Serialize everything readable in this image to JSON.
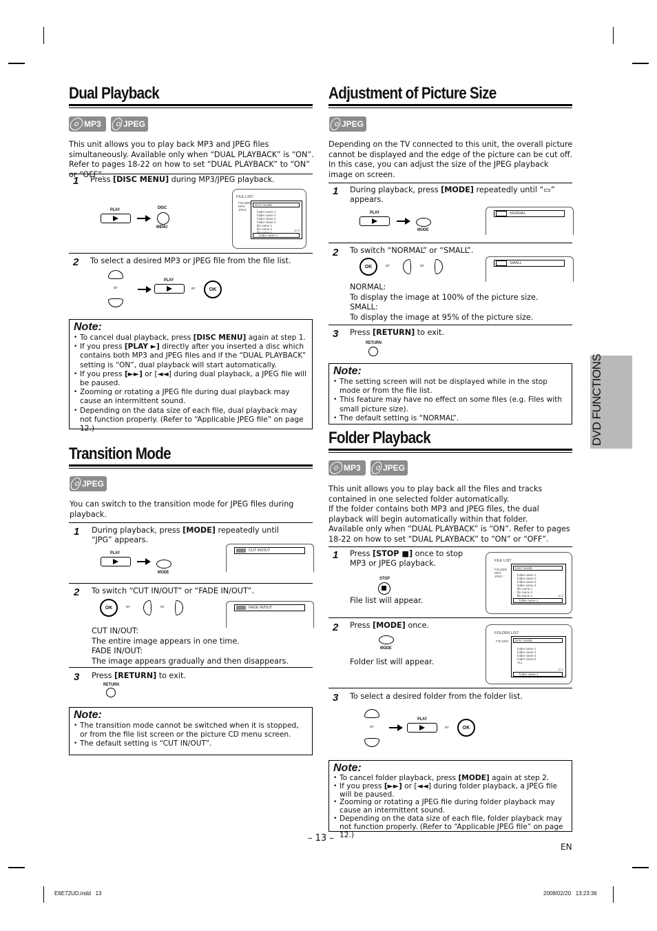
{
  "page": {
    "number_label": "– 13 –",
    "lang": "EN",
    "side_tab": "DVD FUNCTIONS",
    "footer_left": "E6E72UD.indd   13",
    "footer_right": "2008/02/20   13:23:36"
  },
  "badges": {
    "mp3": "MP3",
    "jpeg": "JPEG"
  },
  "buttons": {
    "play": "PLAY",
    "disc_menu_top": "DISC",
    "disc_menu_bottom": "MENU",
    "ok": "OK",
    "mode": "MODE",
    "return": "RETURN",
    "stop": "STOP",
    "or": "or"
  },
  "dual_playback": {
    "title": "Dual Playback",
    "intro": "This unit allows you to play back MP3 and JPEG files simultaneously. Available only when “DUAL PLAYBACK” is “ON”. Refer to pages 18-22 on how to set “DUAL PLAYBACK” to “ON” or “OFF”.",
    "steps": [
      {
        "num": "1",
        "pre": "Press ",
        "bold": "[DISC MENU]",
        "post": " during MP3/JPEG playback."
      },
      {
        "num": "2",
        "text": "To select a desired MP3 or JPEG file from the file list."
      }
    ],
    "file_list": {
      "title": "FILE LIST",
      "disc_name": "DISC NAME",
      "legend": [
        "FOLDER",
        "MP3",
        "JPEG"
      ],
      "rows": [
        "folder name 1",
        "folder name 2",
        "folder name 3",
        "folder name 4",
        "file name 1",
        "file name 2",
        "file name 1"
      ],
      "page": "1/  2",
      "current": "folder name 1"
    },
    "note": {
      "title": "Note:",
      "items": [
        {
          "pre": "To cancel dual playback, press ",
          "bold": "[DISC MENU]",
          "post": " again at step 1."
        },
        {
          "pre": "If you press ",
          "bold": "[PLAY ►]",
          "post": " directly after you inserted a disc which contains both MP3 and JPEG files and if the “DUAL PLAYBACK” setting is “ON”, dual playback will start automatically."
        },
        {
          "pre": "If you press ",
          "bold": "[►►]",
          "post": " or [◄◄] during dual playback, a JPEG file will be paused."
        },
        {
          "pre": "Zooming or rotating a JPEG file during dual playback may cause an intermittent sound.",
          "bold": "",
          "post": ""
        },
        {
          "pre": "Depending on the data size of each file, dual playback may not function properly. (Refer to “Applicable JPEG file” on page 12.)",
          "bold": "",
          "post": ""
        }
      ]
    }
  },
  "transition_mode": {
    "title": "Transition Mode",
    "intro": "You can switch to the transition mode for JPEG files during playback.",
    "steps": [
      {
        "num": "1",
        "pre": "During playback, press ",
        "bold": "[MODE]",
        "post": " repeatedly until “JPG” appears."
      },
      {
        "num": "2",
        "text": "To switch “CUT IN/OUT” or “FADE IN/OUT”."
      },
      {
        "num": "3",
        "pre": "Press ",
        "bold": "[RETURN]",
        "post": " to exit."
      }
    ],
    "osd1": "CUT    IN/OUT",
    "osd2": "FADE  IN/OUT",
    "desc": [
      "CUT IN/OUT:",
      "The entire image appears in one time.",
      "FADE IN/OUT:",
      "The image appears gradually and then disappears."
    ],
    "note": {
      "title": "Note:",
      "items": [
        "The transition mode cannot be switched when it is stopped, or from the file list screen or the picture CD menu screen.",
        "The default setting is “CUT IN/OUT”."
      ]
    }
  },
  "picture_size": {
    "title": "Adjustment of Picture Size",
    "intro": "Depending on the TV connected to this unit, the overall picture cannot be displayed and the edge of the picture can be cut off. In this case, you can adjust the size of the JPEG playback image on screen.",
    "steps": [
      {
        "num": "1",
        "pre": "During playback, press ",
        "bold": "[MODE]",
        "post": " repeatedly until “▭” appears."
      },
      {
        "num": "2",
        "text": "To switch “NORMAL” or “SMALL”."
      },
      {
        "num": "3",
        "pre": "Press ",
        "bold": "[RETURN]",
        "post": " to exit."
      }
    ],
    "osd1": "NORMAL",
    "osd2": "SMALL",
    "desc": [
      "NORMAL:",
      "To display the image at 100% of the picture size.",
      "SMALL:",
      "To display the image at 95% of the picture size."
    ],
    "note": {
      "title": "Note:",
      "items": [
        "The setting screen will not be displayed while in the stop mode or from the file list.",
        "This feature may have no effect on some files (e.g. Files with small picture size).",
        "The default setting is “NORMAL”."
      ]
    }
  },
  "folder_playback": {
    "title": "Folder Playback",
    "intro": "This unit allows you to  play back all the files and tracks contained in one selected folder automatically.\nIf the folder contains both MP3 and JPEG files, the dual playback will begin automatically within that folder.\nAvailable only when “DUAL PLAYBACK” is “ON”. Refer to pages 18-22 on how to set “DUAL PLAYBACK” to “ON” or “OFF”.",
    "steps": [
      {
        "num": "1",
        "pre": "Press ",
        "bold": "[STOP ■]",
        "post": " once to stop MP3 or JPEG playback.",
        "after": "File list will appear."
      },
      {
        "num": "2",
        "pre": "Press ",
        "bold": "[MODE]",
        "post": " once.",
        "after": "Folder list will appear."
      },
      {
        "num": "3",
        "text": "To select a desired folder from the folder list."
      }
    ],
    "file_list": {
      "title": "FILE LIST",
      "disc_name": "DISC NAME",
      "legend": [
        "FOLDER",
        "MP3",
        "JPEG"
      ],
      "rows": [
        "folder name 1",
        "folder name 2",
        "folder name 3",
        "folder name 4",
        "file name 1",
        "file name 2",
        "file name 1"
      ],
      "page": "1/  2",
      "current": "folder name 1"
    },
    "folder_list": {
      "title": "FOLDER LIST",
      "disc_name": "DISC NAME",
      "legend": [
        "FOLDER"
      ],
      "rows": [
        "folder name 1",
        "folder name 2",
        "folder name 3",
        "folder name 5",
        "ALL"
      ],
      "page": "1/  1",
      "current": "folder name 1"
    },
    "note": {
      "title": "Note:",
      "items": [
        {
          "pre": "To cancel folder playback, press ",
          "bold": "[MODE]",
          "post": " again at step 2."
        },
        {
          "pre": "If you press ",
          "bold": "[►►]",
          "post": " or [◄◄]  during folder playback, a JPEG file will be paused."
        },
        {
          "pre": "Zooming or rotating a JPEG file during folder playback may cause an intermittent sound.",
          "bold": "",
          "post": ""
        },
        {
          "pre": "Depending on the data size of each file, folder playback may not function properly. (Refer to “Applicable JPEG file” on page 12.)",
          "bold": "",
          "post": ""
        }
      ]
    }
  }
}
